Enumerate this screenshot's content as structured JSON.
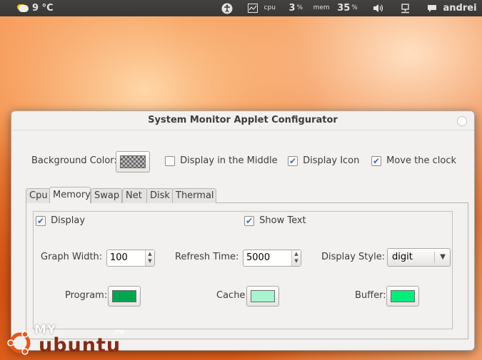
{
  "topbar": {
    "weather": "9 °C",
    "cpu_label": "cpu",
    "cpu_value": "3",
    "cpu_unit": "%",
    "mem_label": "mem",
    "mem_value": "35",
    "mem_unit": "%",
    "user": "andrei"
  },
  "dialog": {
    "title": "System Monitor Applet Configurator",
    "background_color_label": "Background Color:",
    "display_middle_label": "Display in the Middle",
    "display_middle_checked": false,
    "display_icon_label": "Display Icon",
    "display_icon_checked": true,
    "move_clock_label": "Move the clock",
    "move_clock_checked": true,
    "tabs": [
      {
        "label": "Cpu",
        "active": false
      },
      {
        "label": "Memory",
        "active": true
      },
      {
        "label": "Swap",
        "active": false
      },
      {
        "label": "Net",
        "active": false
      },
      {
        "label": "Disk",
        "active": false
      },
      {
        "label": "Thermal",
        "active": false
      }
    ],
    "memory": {
      "display_label": "Display",
      "display_checked": true,
      "show_text_label": "Show Text",
      "show_text_checked": true,
      "graph_width_label": "Graph Width:",
      "graph_width_value": "100",
      "refresh_time_label": "Refresh Time:",
      "refresh_time_value": "5000",
      "display_style_label": "Display Style:",
      "display_style_value": "digit",
      "program_label": "Program:",
      "program_color": "#00a550",
      "cache_label": "Cache:",
      "cache_color": "#a6f5d0",
      "buffer_label": "Buffer:",
      "buffer_color": "#00ee7a"
    }
  },
  "logo": {
    "my": "MY",
    "ru": ".ru",
    "ubuntu": "ubuntu"
  }
}
